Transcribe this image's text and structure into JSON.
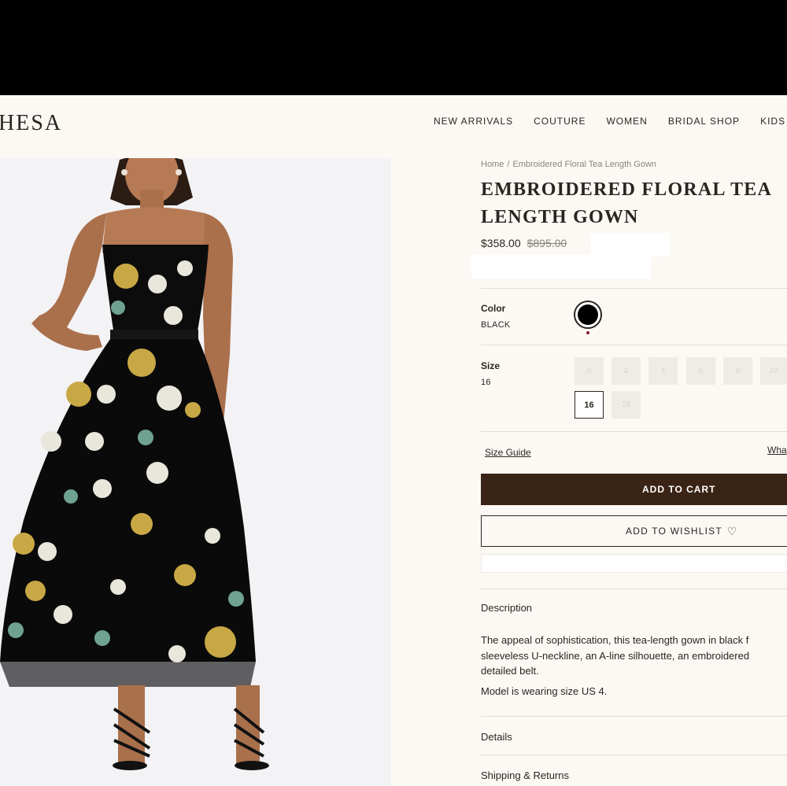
{
  "header": {
    "logo": "HESA",
    "nav": [
      "NEW ARRIVALS",
      "COUTURE",
      "WOMEN",
      "BRIDAL SHOP",
      "KIDS"
    ]
  },
  "breadcrumb": {
    "home": "Home",
    "separator": "/",
    "current": "Embroidered Floral Tea Length Gown"
  },
  "product": {
    "title": "EMBROIDERED FLORAL TEA LENGTH GOWN",
    "price": "$358.00",
    "original_price": "$895.00",
    "color_label": "Color",
    "color_value": "BLACK",
    "size_label": "Size",
    "size_value": "16",
    "sizes": [
      "0",
      "2",
      "4",
      "6",
      "8",
      "10",
      "16",
      "18"
    ],
    "selected_size": "16"
  },
  "links": {
    "size_guide": "Size Guide",
    "whats": "Wha"
  },
  "buttons": {
    "add_to_cart": "ADD TO CART",
    "add_to_wishlist": "ADD TO WISHLIST"
  },
  "sections": {
    "description": "Description",
    "description_lines": [
      "The appeal of sophistication, this tea-length gown in black f",
      "sleeveless U-neckline, an A-line silhouette, an embroidered",
      "detailed belt."
    ],
    "model_note": "Model is wearing size US 4.",
    "details": "Details",
    "shipping": "Shipping & Returns"
  },
  "colors": {
    "accent": "#3a2415",
    "background": "#fcf9f5",
    "text": "#2a2520",
    "muted": "#8a837b"
  },
  "icons": {
    "heart": "heart-icon"
  }
}
